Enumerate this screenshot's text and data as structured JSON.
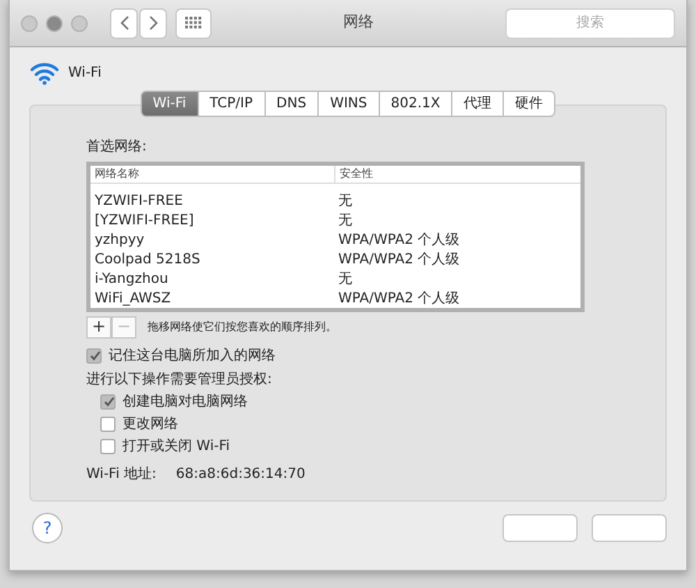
{
  "window": {
    "title": "网络"
  },
  "search": {
    "placeholder": "搜索"
  },
  "service": {
    "name": "Wi-Fi"
  },
  "tabs": [
    {
      "label": "Wi-Fi",
      "selected": true
    },
    {
      "label": "TCP/IP",
      "selected": false
    },
    {
      "label": "DNS",
      "selected": false
    },
    {
      "label": "WINS",
      "selected": false
    },
    {
      "label": "802.1X",
      "selected": false
    },
    {
      "label": "代理",
      "selected": false
    },
    {
      "label": "硬件",
      "selected": false
    }
  ],
  "preferred_networks": {
    "label": "首选网络:",
    "columns": [
      "网络名称",
      "安全性"
    ],
    "rows": [
      [
        "YZWIFI-FREE",
        "无"
      ],
      [
        "[YZWIFI-FREE]",
        "无"
      ],
      [
        "yzhpyy",
        "WPA/WPA2 个人级"
      ],
      [
        "Coolpad 5218S",
        "WPA/WPA2 个人级"
      ],
      [
        "i-Yangzhou",
        "无"
      ],
      [
        "WiFi_AWSZ",
        "WPA/WPA2 个人级"
      ]
    ],
    "add": "+",
    "remove": "−",
    "hint": "拖移网络使它们按您喜欢的顺序排列。"
  },
  "remember": {
    "label": "记住这台电脑所加入的网络",
    "checked": true
  },
  "admin": {
    "label": "进行以下操作需要管理员授权:",
    "options": [
      {
        "label": "创建电脑对电脑网络",
        "checked": true
      },
      {
        "label": "更改网络",
        "checked": false
      },
      {
        "label": "打开或关闭 Wi-Fi",
        "checked": false
      }
    ]
  },
  "address": {
    "label": "Wi-Fi 地址:",
    "value": "68:a8:6d:36:14:70"
  },
  "help": "?"
}
